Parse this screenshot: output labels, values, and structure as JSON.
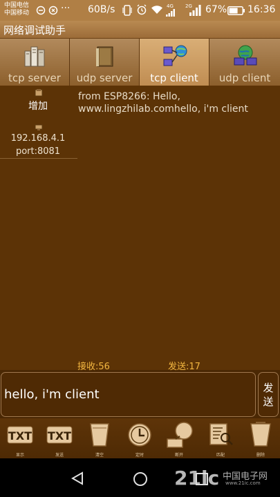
{
  "status_bar": {
    "carrier_1": "中国电信",
    "carrier_2": "中国移动",
    "network_speed": "60B/s",
    "network_4g": "4G",
    "network_2g": "2G",
    "battery_percent": "67%",
    "battery_level": 0.67,
    "time": "16:36"
  },
  "app": {
    "title": "网络调试助手"
  },
  "tabs": [
    {
      "label": "tcp server",
      "active": false,
      "icon": "server-rack-icon"
    },
    {
      "label": "udp server",
      "active": false,
      "icon": "book-icon"
    },
    {
      "label": "tcp client",
      "active": true,
      "icon": "network-client-icon"
    },
    {
      "label": "udp client",
      "active": false,
      "icon": "globe-computer-icon"
    }
  ],
  "connections": {
    "add_label": "增加",
    "items": [
      {
        "ip": "192.168.4.1",
        "port": "port:8081"
      }
    ]
  },
  "log": {
    "text": "from ESP8266: Hello, www.lingzhilab.comhello, i'm client"
  },
  "counters": {
    "received": "接收:56",
    "sent": "发送:17"
  },
  "message": {
    "value": "hello, i'm client",
    "send_label": "发送"
  },
  "toolbar": {
    "items": [
      {
        "label": "显示",
        "icon": "txt-display-icon"
      },
      {
        "label": "发送",
        "icon": "txt-send-icon"
      },
      {
        "label": "清空",
        "icon": "clear-cup-icon"
      },
      {
        "label": "定时",
        "icon": "clock-icon"
      },
      {
        "label": "断开",
        "icon": "disconnect-icon"
      },
      {
        "label": "匹配",
        "icon": "match-search-icon"
      },
      {
        "label": "删除",
        "icon": "delete-cup-icon"
      }
    ]
  },
  "watermark": {
    "logo": "21ic",
    "cn": "中国电子网",
    "url": "www.21ic.com"
  },
  "colors": {
    "accent": "#f2b640",
    "background": "#5c3306",
    "titlebar": "#b07f45"
  }
}
